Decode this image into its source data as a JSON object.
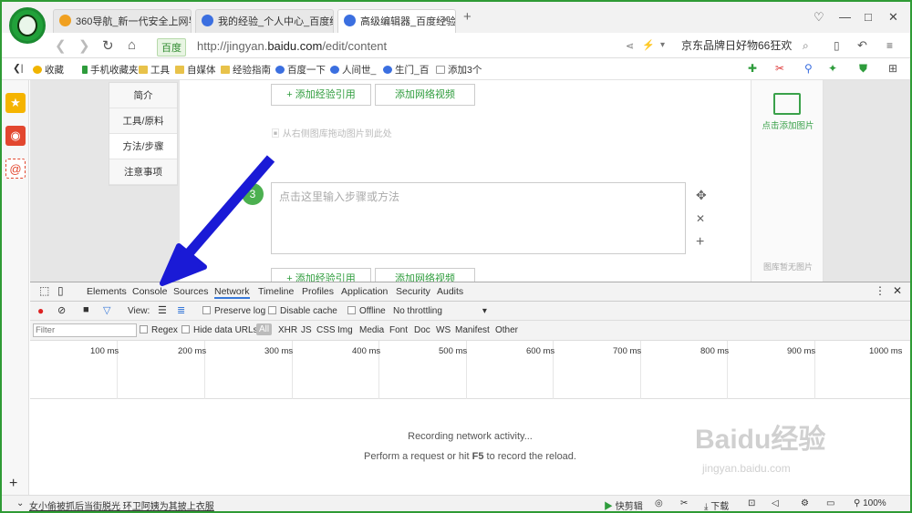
{
  "tabs": [
    {
      "label": "360导航_新一代安全上网导",
      "color": "#f0a020"
    },
    {
      "label": "我的经验_个人中心_百度经",
      "color": "#3b6fe0"
    },
    {
      "label": "高级编辑器_百度经验",
      "color": "#3b6fe0"
    }
  ],
  "address": {
    "badge": "百度",
    "url_prefix": "http://jingyan.",
    "url_domain": "baidu.com",
    "url_path": "/edit/content",
    "search_text": "京东品牌日好物66狂欢"
  },
  "bookmarks": [
    "收藏",
    "手机收藏夹",
    "工具",
    "自媒体",
    "经验指南",
    "百度一下",
    "人间世_",
    "生门_百",
    "添加3个"
  ],
  "left_nav": [
    "简介",
    "工具/原料",
    "方法/步骤",
    "注意事项"
  ],
  "editor": {
    "btn_cite": "+ 添加经验引用",
    "btn_video": "添加网络视频",
    "image_hint": "从右侧图库拖动图片到此处",
    "step_number": "3",
    "step_placeholder": "点击这里输入步骤或方法",
    "right_add": "点击添加图片",
    "right_empty": "图库暂无图片"
  },
  "devtools": {
    "tabs": [
      "Elements",
      "Console",
      "Sources",
      "Network",
      "Timeline",
      "Profiles",
      "Application",
      "Security",
      "Audits"
    ],
    "selected_tab": "Network",
    "view_label": "View:",
    "preserve_log": "Preserve log",
    "disable_cache": "Disable cache",
    "offline": "Offline",
    "throttling": "No throttling",
    "filter_placeholder": "Filter",
    "regex": "Regex",
    "hide_data_urls": "Hide data URLs",
    "types": [
      "All",
      "XHR",
      "JS",
      "CSS",
      "Img",
      "Media",
      "Font",
      "Doc",
      "WS",
      "Manifest",
      "Other"
    ],
    "ticks": [
      "100 ms",
      "200 ms",
      "300 ms",
      "400 ms",
      "500 ms",
      "600 ms",
      "700 ms",
      "800 ms",
      "900 ms",
      "1000 ms"
    ],
    "recording": "Recording network activity...",
    "hint_prefix": "Perform a request or hit",
    "hint_key": "F5",
    "hint_suffix": "to record the reload."
  },
  "status": {
    "news": "女小偷被抓后当街脱光 环卫阿姨为其披上衣服",
    "quick_cut": "快剪辑",
    "download": "下载",
    "zoom": "100%"
  },
  "watermark": {
    "main": "Baidu经验",
    "sub": "jingyan.baidu.com"
  },
  "colors": {
    "frame": "#2f9b35",
    "accent_green": "#2e9c3c",
    "devtools_blue": "#3879d9",
    "arrow": "#1a1ad6"
  }
}
